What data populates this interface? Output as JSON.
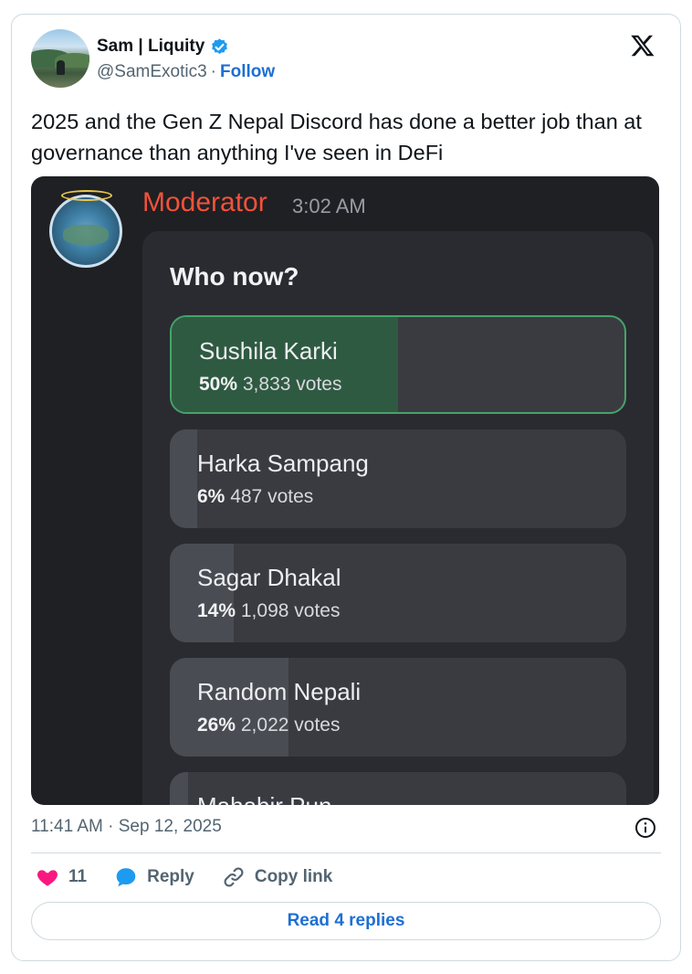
{
  "author": {
    "display_name": "Sam | Liquity",
    "handle": "@SamExotic3",
    "separator": "·",
    "follow_label": "Follow"
  },
  "tweet": {
    "text": "2025 and the Gen Z Nepal Discord has done a better job than at governance than anything I've seen in DeFi",
    "timestamp": "11:41 AM · Sep 12, 2025"
  },
  "media": {
    "moderator_name": "Moderator",
    "moderator_time": "3:02 AM",
    "poll": {
      "question": "Who now?",
      "options": [
        {
          "label": "Sushila Karki",
          "percent": "50%",
          "votes": "3,833 votes",
          "share": 0.5,
          "winner": true
        },
        {
          "label": "Harka Sampang",
          "percent": "6%",
          "votes": "487 votes",
          "share": 0.06,
          "winner": false
        },
        {
          "label": "Sagar Dhakal",
          "percent": "14%",
          "votes": "1,098 votes",
          "share": 0.14,
          "winner": false
        },
        {
          "label": "Random Nepali",
          "percent": "26%",
          "votes": "2,022 votes",
          "share": 0.26,
          "winner": false
        },
        {
          "label": "Mahabir Pun",
          "percent": "",
          "votes": "",
          "share": 0.04,
          "winner": false
        }
      ]
    }
  },
  "actions": {
    "like_count": "11",
    "reply_label": "Reply",
    "copy_link_label": "Copy link",
    "read_replies_label": "Read 4 replies"
  },
  "colors": {
    "follow": "#1d6fd4",
    "like": "#f91880",
    "reply": "#1d9bf0",
    "moderator": "#f2523a",
    "winner_border": "#45a36a"
  }
}
